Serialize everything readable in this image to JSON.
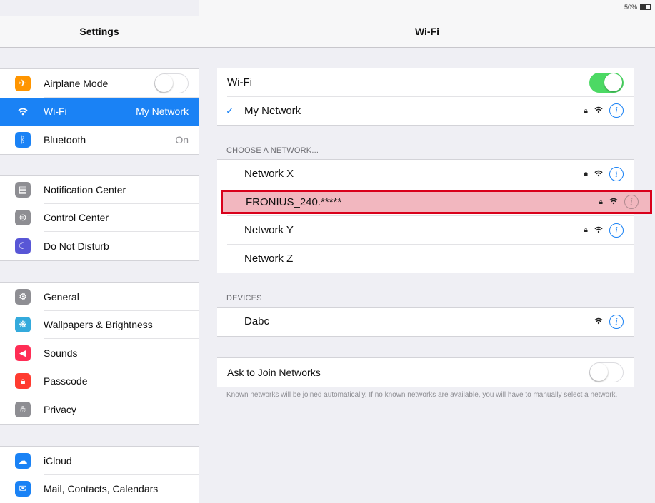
{
  "status_bar": {
    "device": "iPad",
    "battery": "50%"
  },
  "sidebar": {
    "title": "Settings",
    "groups": [
      [
        {
          "label": "Airplane Mode",
          "icon": "airplane-icon",
          "color": "#ff9500"
        },
        {
          "label": "Wi-Fi",
          "value": "My Network",
          "icon": "wifi-icon",
          "color": "#1a82f5",
          "selected": true
        },
        {
          "label": "Bluetooth",
          "value": "On",
          "icon": "bluetooth-icon",
          "color": "#1a82f5"
        }
      ],
      [
        {
          "label": "Notification Center",
          "icon": "notification-center-icon",
          "color": "#8e8e93"
        },
        {
          "label": "Control Center",
          "icon": "control-center-icon",
          "color": "#8e8e93"
        },
        {
          "label": "Do Not Disturb",
          "icon": "moon-icon",
          "color": "#5856d6"
        }
      ],
      [
        {
          "label": "General",
          "icon": "gear-icon",
          "color": "#8e8e93"
        },
        {
          "label": "Wallpapers & Brightness",
          "icon": "flower-icon",
          "color": "#34aadc"
        },
        {
          "label": "Sounds",
          "icon": "speaker-icon",
          "color": "#ff2d55"
        },
        {
          "label": "Passcode",
          "icon": "lock-icon",
          "color": "#ff3b30"
        },
        {
          "label": "Privacy",
          "icon": "hand-icon",
          "color": "#8e8e93"
        }
      ],
      [
        {
          "label": "iCloud",
          "icon": "cloud-icon",
          "color": "#1a82f5"
        },
        {
          "label": "Mail, Contacts, Calendars",
          "icon": "mail-icon",
          "color": "#1a82f5"
        }
      ]
    ]
  },
  "main": {
    "title": "Wi-Fi",
    "wifi_label": "Wi-Fi",
    "wifi_on": true,
    "connected_network": "My Network",
    "choose_title": "CHOOSE A NETWORK...",
    "networks": [
      {
        "name": "Network X",
        "locked": true,
        "highlight": false
      },
      {
        "name": "FRONIUS_240.*****",
        "locked": true,
        "highlight": true
      },
      {
        "name": "Network Y",
        "locked": true,
        "highlight": false
      },
      {
        "name": "Network Z",
        "locked": false,
        "highlight": false,
        "no_icons": true
      }
    ],
    "devices_title": "DEVICES",
    "devices": [
      {
        "name": "Dabc"
      }
    ],
    "ask_to_join_label": "Ask to Join Networks",
    "ask_to_join_on": false,
    "footnote": "Known networks will be joined automatically. If no known networks are available, you will have to manually select a network."
  }
}
